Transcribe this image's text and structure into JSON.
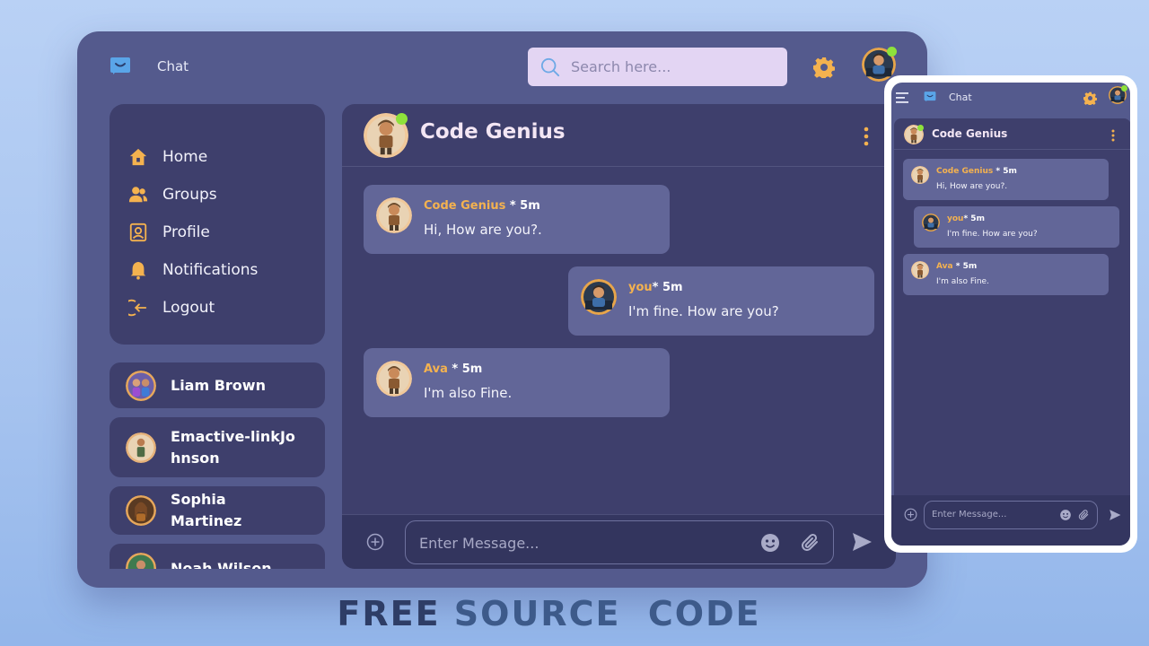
{
  "app": {
    "title": "Chat",
    "colors": {
      "window": "#545a8d",
      "panel": "#3e3f6c",
      "bubble": "#626698",
      "accent": "#f4b24f",
      "online": "#8ee23b"
    }
  },
  "search": {
    "placeholder": "Search here..."
  },
  "nav": {
    "items": [
      {
        "label": "Home",
        "icon": "home-icon"
      },
      {
        "label": "Groups",
        "icon": "groups-icon"
      },
      {
        "label": "Profile",
        "icon": "profile-icon"
      },
      {
        "label": "Notifications",
        "icon": "bell-icon"
      },
      {
        "label": "Logout",
        "icon": "logout-icon"
      }
    ]
  },
  "contacts": [
    {
      "name": "Liam Brown"
    },
    {
      "name": "Emactive-linkJohnson"
    },
    {
      "name": "Sophia Martinez"
    },
    {
      "name": "Noah Wilson"
    }
  ],
  "chat": {
    "title": "Code Genius",
    "messages": [
      {
        "author": "Code Genius",
        "meta": " * 5m",
        "text": "Hi, How are you?."
      },
      {
        "author": "you",
        "meta": "* 5m",
        "text": "I'm fine. How are you?"
      },
      {
        "author": "Ava",
        "meta": " * 5m",
        "text": "I'm also Fine."
      }
    ],
    "composer_placeholder": "Enter Message..."
  },
  "mobile": {
    "title": "Chat",
    "chat_title": "Code Genius",
    "messages": [
      {
        "author": "Code Genius",
        "meta": " * 5m",
        "text": "Hi, How are you?."
      },
      {
        "author": "you",
        "meta": "* 5m",
        "text": "I'm fine. How are you?"
      },
      {
        "author": "Ava",
        "meta": " * 5m",
        "text": "I'm also Fine."
      }
    ],
    "composer_placeholder": "Enter Message..."
  },
  "caption": {
    "part1": "FREE",
    "part2": "SOURCE  CODE"
  }
}
